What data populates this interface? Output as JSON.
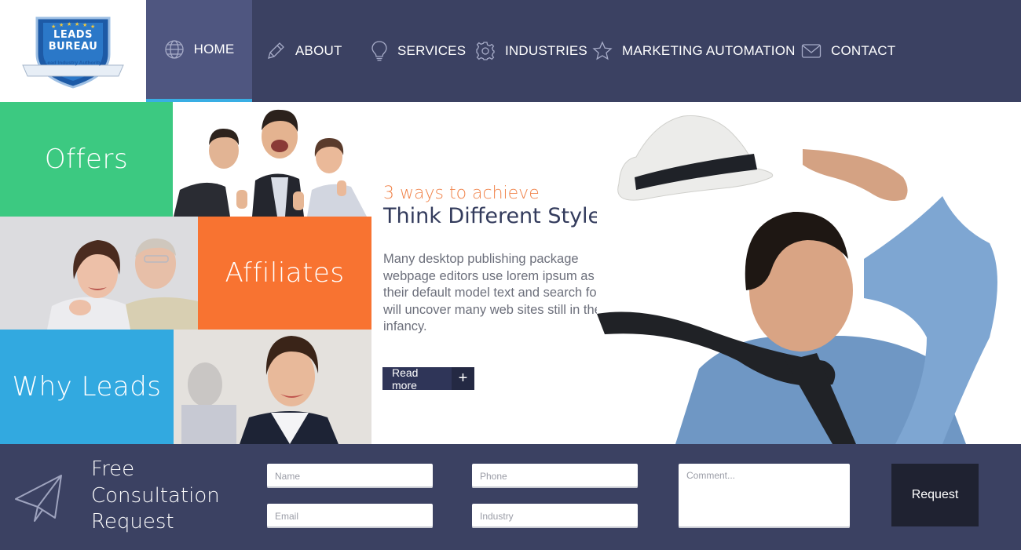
{
  "logo": {
    "line1": "LEADS",
    "line2": "BUREAU",
    "tagline": "Lead Industry Authority",
    "icon": "shield-logo"
  },
  "nav": {
    "items": [
      {
        "label": "HOME",
        "icon": "globe-icon",
        "active": true
      },
      {
        "label": "ABOUT",
        "icon": "pencil-icon",
        "active": false
      },
      {
        "label": "SERVICES",
        "icon": "lightbulb-icon",
        "active": false
      },
      {
        "label": "INDUSTRIES",
        "icon": "gear-icon",
        "active": false
      },
      {
        "label": "MARKETING AUTOMATION",
        "icon": "star-icon",
        "active": false
      },
      {
        "label": "CONTACT",
        "icon": "envelope-icon",
        "active": false
      }
    ]
  },
  "tiles": {
    "offers": "Offers",
    "affiliates": "Affiliates",
    "why": "Why Leads"
  },
  "hero": {
    "subtitle": "3 ways to achieve",
    "title": "Think Different Style",
    "body": "Many desktop publishing package webpage editors use lorem ipsum as their default model text and search for will uncover many web sites still in their infancy.",
    "read_more": "Read more",
    "plus": "+"
  },
  "consultation": {
    "title_line1": "Free",
    "title_line2": "Consultation",
    "title_line3": "Request",
    "name_placeholder": "Name",
    "email_placeholder": "Email",
    "phone_placeholder": "Phone",
    "industry_placeholder": "Industry",
    "comment_placeholder": "Comment...",
    "request_label": "Request"
  },
  "colors": {
    "nav_bg": "#3b4162",
    "nav_active": "#4f5680",
    "accent_blue": "#39aee4",
    "green": "#3cc981",
    "orange": "#f87331",
    "blue": "#32a9e0"
  }
}
